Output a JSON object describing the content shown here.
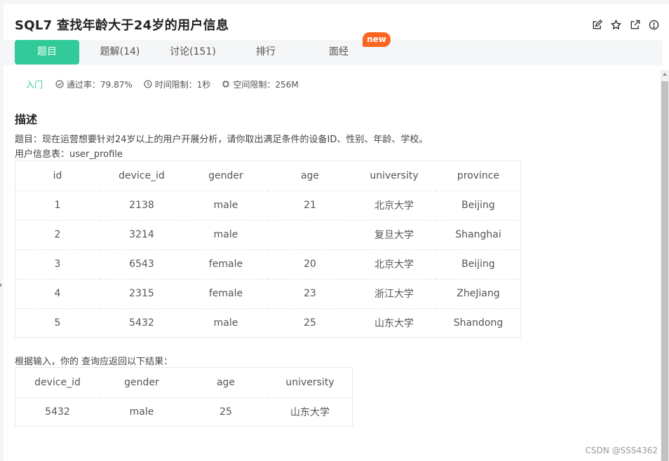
{
  "problem": {
    "title": "SQL7  查找年龄大于24岁的用户信息",
    "icons": [
      "edit-icon",
      "star-icon",
      "share-icon",
      "report-icon"
    ]
  },
  "tabs": [
    {
      "label": "题目",
      "active": true
    },
    {
      "label": "题解(14)",
      "active": false
    },
    {
      "label": "讨论(151)",
      "active": false
    },
    {
      "label": "排行",
      "active": false
    },
    {
      "label": "面经",
      "active": false
    }
  ],
  "badge": "new",
  "meta": {
    "level": "入门",
    "pass_rate": "通过率：79.87%",
    "time_limit": "时间限制：1秒",
    "space_limit": "空间限制：256M"
  },
  "description": {
    "heading": "描述",
    "line1": "题目：现在运营想要针对24岁以上的用户开展分析，请你取出满足条件的设备ID、性别、年龄、学校。",
    "line2": "用户信息表：user_profile",
    "result_intro": "根据输入，你的 查询应返回以下结果："
  },
  "user_profile": {
    "columns": [
      "id",
      "device_id",
      "gender",
      "age",
      "university",
      "province"
    ],
    "rows": [
      [
        "1",
        "2138",
        "male",
        "21",
        "北京大学",
        "Beijing"
      ],
      [
        "2",
        "3214",
        "male",
        "",
        "复旦大学",
        "Shanghai"
      ],
      [
        "3",
        "6543",
        "female",
        "20",
        "北京大学",
        "Beijing"
      ],
      [
        "4",
        "2315",
        "female",
        "23",
        "浙江大学",
        "ZheJiang"
      ],
      [
        "5",
        "5432",
        "male",
        "25",
        "山东大学",
        "Shandong"
      ]
    ]
  },
  "result": {
    "columns": [
      "device_id",
      "gender",
      "age",
      "university"
    ],
    "rows": [
      [
        "5432",
        "male",
        "25",
        "山东大学"
      ]
    ]
  },
  "watermark": "CSDN @SSS4362",
  "colors": {
    "accent": "#32ca99",
    "badge": "#fa6620"
  }
}
